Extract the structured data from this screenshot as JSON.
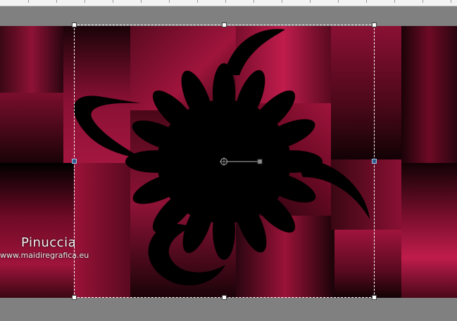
{
  "canvas": {
    "background_gradient_colors": [
      "#6e0a25",
      "#2a0610",
      "#a0143c",
      "#000000"
    ],
    "shape_color": "#000000"
  },
  "watermark": {
    "name": "Pinuccia",
    "url": "www.maidiregrafica.eu"
  },
  "tool": {
    "type": "pick-tool-selection",
    "rotation_handle_icon": "rotation-handle-icon"
  }
}
